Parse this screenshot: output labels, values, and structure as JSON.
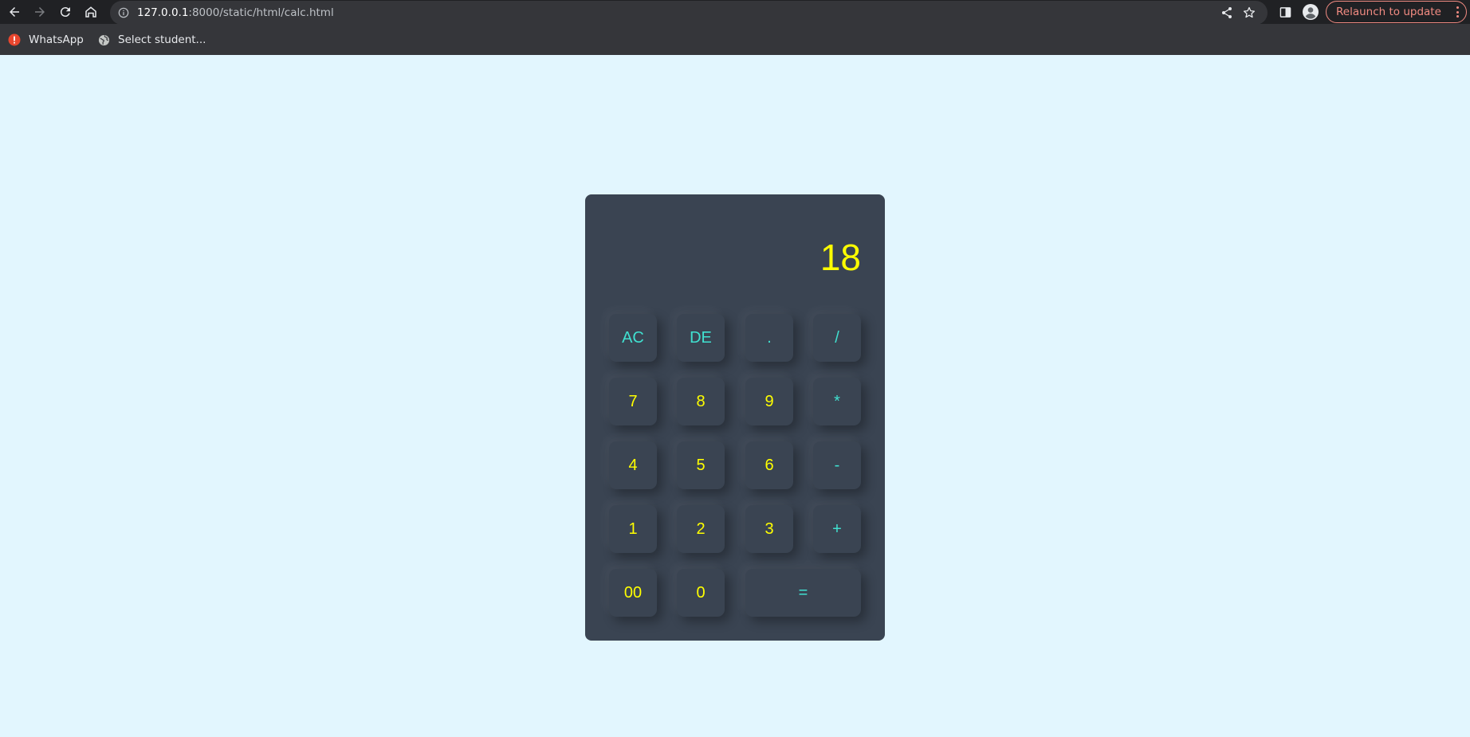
{
  "browser": {
    "url_host": "127.0.0.1",
    "url_path": ":8000/static/html/calc.html",
    "relaunch_label": "Relaunch to update",
    "bookmarks": [
      {
        "label": "WhatsApp",
        "icon": "alert-icon"
      },
      {
        "label": "Select student...",
        "icon": "globe-icon"
      }
    ]
  },
  "colors": {
    "page_background": "#e2f6fe",
    "calculator_body": "#3a4452",
    "operator_key": "#40e0d0",
    "number_key": "#ffff00",
    "relaunch_accent": "#f28b82"
  },
  "calculator": {
    "display_value": "18",
    "keys": {
      "ac": "AC",
      "de": "DE",
      "dot": ".",
      "divide": "/",
      "seven": "7",
      "eight": "8",
      "nine": "9",
      "multiply": "*",
      "four": "4",
      "five": "5",
      "six": "6",
      "minus": "-",
      "one": "1",
      "two": "2",
      "three": "3",
      "plus": "+",
      "double_zero": "00",
      "zero": "0",
      "equals": "="
    }
  }
}
